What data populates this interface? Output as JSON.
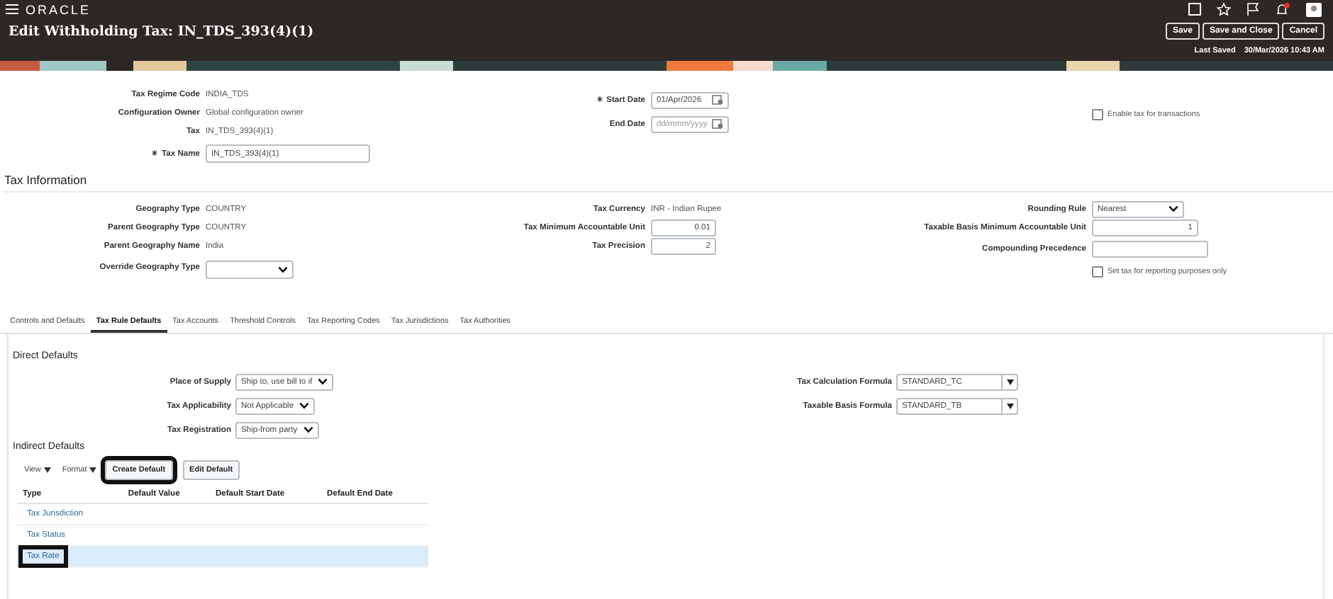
{
  "topbar": {
    "logo": "ORACLE"
  },
  "header": {
    "title": "Edit Withholding Tax: IN_TDS_393(4)(1)",
    "last_saved_label": "Last Saved",
    "last_saved_value": "30/Mar/2026 10:43 AM",
    "buttons": [
      {
        "label": "Save"
      },
      {
        "label": "Save and Close"
      },
      {
        "label": "Cancel"
      }
    ]
  },
  "general": {
    "columns": [
      [
        {
          "kind": "text",
          "label": "Tax Regime Code",
          "value": "INDIA_TDS",
          "required": false
        },
        {
          "kind": "text",
          "label": "Configuration Owner",
          "value": "Global configuration owner",
          "required": false
        },
        {
          "kind": "text",
          "label": "Tax",
          "value": "IN_TDS_393(4)(1)",
          "required": false
        },
        {
          "kind": "input",
          "label": "Tax Name",
          "value": "IN_TDS_393(4)(1)",
          "required": true
        }
      ],
      [
        {
          "kind": "date",
          "label": "Start Date",
          "value": "01/Apr/2026",
          "required": true
        },
        {
          "kind": "date",
          "label": "End Date",
          "placeholder": "dd/mmm/yyyy",
          "required": false
        }
      ],
      [
        {
          "kind": "checkbox",
          "label": "Enable tax for transactions",
          "checked": false
        }
      ]
    ]
  },
  "tax_information": {
    "title": "Tax Information",
    "columns": [
      [
        {
          "kind": "text",
          "label": "Geography Type",
          "value": "COUNTRY"
        },
        {
          "kind": "text",
          "label": "Parent Geography Type",
          "value": "COUNTRY"
        },
        {
          "kind": "text",
          "label": "Parent Geography Name",
          "value": "India"
        },
        {
          "kind": "select",
          "label": "Override Geography Type"
        }
      ],
      [
        {
          "kind": "text",
          "label": "Tax Currency",
          "value": "INR - Indian Rupee"
        },
        {
          "kind": "number",
          "label": "Tax Minimum Accountable Unit",
          "value": "0.01"
        },
        {
          "kind": "number",
          "label": "Tax Precision",
          "value": "2"
        }
      ],
      [
        {
          "kind": "select",
          "label": "Rounding Rule",
          "value": "Nearest"
        },
        {
          "kind": "number",
          "label": "Taxable Basis Minimum Accountable Unit",
          "value": "1"
        },
        {
          "kind": "input",
          "label": "Compounding Precedence"
        },
        {
          "kind": "checkbox",
          "label": "Set tax for reporting purposes only",
          "checked": false
        }
      ]
    ]
  },
  "tabs": [
    {
      "label": "Controls and Defaults",
      "selected": false
    },
    {
      "label": "Tax Rule Defaults",
      "selected": true
    },
    {
      "label": "Tax Accounts",
      "selected": false
    },
    {
      "label": "Threshold Controls",
      "selected": false
    },
    {
      "label": "Tax Reporting Codes",
      "selected": false
    },
    {
      "label": "Tax Jurisdictions",
      "selected": false
    },
    {
      "label": "Tax Authorities",
      "selected": false
    }
  ],
  "direct_defaults": {
    "title": "Direct Defaults",
    "columns": [
      [
        {
          "kind": "select",
          "label": "Place of Supply",
          "value": "Ship to, use bill to if"
        },
        {
          "kind": "select",
          "label": "Tax Applicability",
          "value": "Not Applicable"
        },
        {
          "kind": "select",
          "label": "Tax Registration",
          "value": "Ship-from party"
        }
      ],
      [
        {
          "kind": "combobox",
          "label": "Tax Calculation Formula",
          "value": "STANDARD_TC"
        },
        {
          "kind": "combobox",
          "label": "Taxable Basis Formula",
          "value": "STANDARD_TB"
        }
      ]
    ]
  },
  "indirect_defaults": {
    "title": "Indirect Defaults",
    "menus": [
      "View",
      "Format"
    ],
    "buttons": [
      {
        "label": "Create Default",
        "highlighted": true
      },
      {
        "label": "Edit Default",
        "highlighted": false
      }
    ],
    "table": {
      "columns": [
        "Type",
        "Default Value",
        "Default Start Date",
        "Default End Date"
      ],
      "rows": [
        {
          "type": "Tax Jurisdiction",
          "selected": false,
          "highlighted": false
        },
        {
          "type": "Tax Status",
          "selected": false,
          "highlighted": false
        },
        {
          "type": "Tax Rate",
          "selected": true,
          "highlighted": true
        }
      ]
    }
  }
}
